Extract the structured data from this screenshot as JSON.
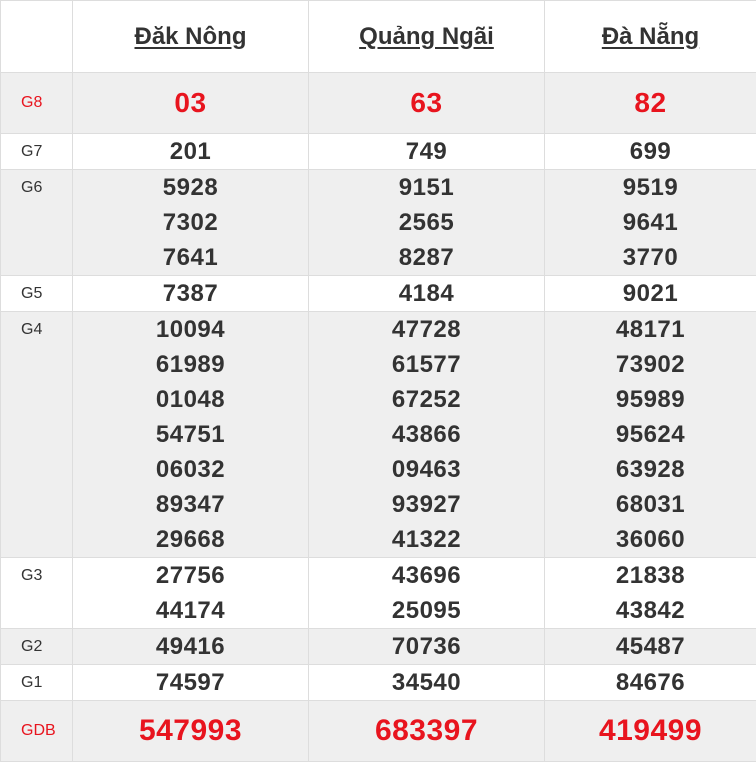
{
  "provinces": [
    "Đăk Nông",
    "Quảng Ngãi",
    "Đà Nẵng"
  ],
  "colors": {
    "accent_red": "#e8141e",
    "text": "#333333",
    "row_shade": "#efefef"
  },
  "prizes": [
    {
      "label": "G8",
      "values": [
        [
          "03"
        ],
        [
          "63"
        ],
        [
          "82"
        ]
      ]
    },
    {
      "label": "G7",
      "values": [
        [
          "201"
        ],
        [
          "749"
        ],
        [
          "699"
        ]
      ]
    },
    {
      "label": "G6",
      "values": [
        [
          "5928",
          "7302",
          "7641"
        ],
        [
          "9151",
          "2565",
          "8287"
        ],
        [
          "9519",
          "9641",
          "3770"
        ]
      ]
    },
    {
      "label": "G5",
      "values": [
        [
          "7387"
        ],
        [
          "4184"
        ],
        [
          "9021"
        ]
      ]
    },
    {
      "label": "G4",
      "values": [
        [
          "10094",
          "61989",
          "01048",
          "54751",
          "06032",
          "89347",
          "29668"
        ],
        [
          "47728",
          "61577",
          "67252",
          "43866",
          "09463",
          "93927",
          "41322"
        ],
        [
          "48171",
          "73902",
          "95989",
          "95624",
          "63928",
          "68031",
          "36060"
        ]
      ]
    },
    {
      "label": "G3",
      "values": [
        [
          "27756",
          "44174"
        ],
        [
          "43696",
          "25095"
        ],
        [
          "21838",
          "43842"
        ]
      ]
    },
    {
      "label": "G2",
      "values": [
        [
          "49416"
        ],
        [
          "70736"
        ],
        [
          "45487"
        ]
      ]
    },
    {
      "label": "G1",
      "values": [
        [
          "74597"
        ],
        [
          "34540"
        ],
        [
          "84676"
        ]
      ]
    },
    {
      "label": "GDB",
      "values": [
        [
          "547993"
        ],
        [
          "683397"
        ],
        [
          "419499"
        ]
      ]
    }
  ]
}
